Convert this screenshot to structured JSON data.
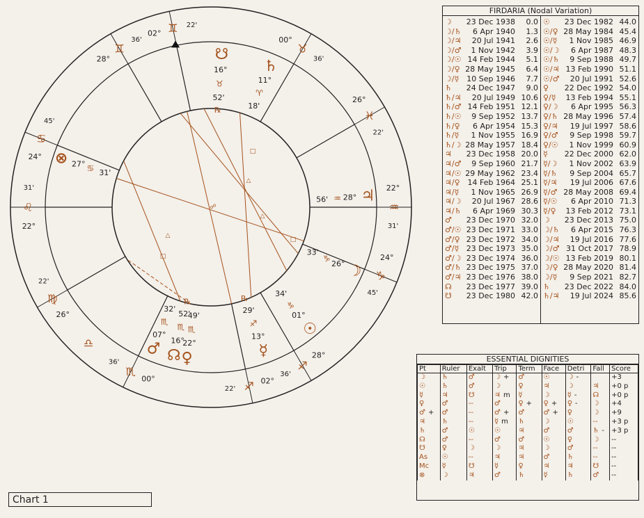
{
  "chart_label": "Chart 1",
  "wheel": {
    "cusps": [
      {
        "deg": "02°",
        "sign": "♊",
        "min": "22'"
      },
      {
        "deg": "00°",
        "sign": "♉",
        "min": "36'"
      },
      {
        "deg": "26°",
        "sign": "♓",
        "min": "22'"
      },
      {
        "deg": "22°",
        "sign": "♒",
        "min": "31'"
      },
      {
        "deg": "24°",
        "sign": "♑",
        "min": "45'"
      },
      {
        "deg": "28°",
        "sign": "♐",
        "min": "36'"
      },
      {
        "deg": "02°",
        "sign": "♐",
        "min": "22'"
      },
      {
        "deg": "00°",
        "sign": "♏",
        "min": "36'"
      },
      {
        "deg": "26°",
        "sign": "♍",
        "min": "22'"
      },
      {
        "deg": "22°",
        "sign": "♌",
        "min": "31'"
      },
      {
        "deg": "24°",
        "sign": "♋",
        "min": "45'"
      },
      {
        "deg": "28°",
        "sign": "♊",
        "min": "36'"
      }
    ],
    "extra_sign_glyph": "♎",
    "planets": [
      {
        "name": "south-node",
        "glyph": "☋",
        "deg": "16°",
        "sign": "♉",
        "min": "52'",
        "retro": "℞"
      },
      {
        "name": "saturn",
        "glyph": "♄",
        "deg": "11°",
        "sign": "♈",
        "min": "18'",
        "retro": ""
      },
      {
        "name": "jupiter",
        "glyph": "♃",
        "deg": "28°",
        "sign": "♒",
        "min": "56'",
        "retro": ""
      },
      {
        "name": "moon",
        "glyph": "☽",
        "deg": "26°",
        "sign": "♑",
        "min": "33'",
        "retro": ""
      },
      {
        "name": "sun",
        "glyph": "☉",
        "deg": "01°",
        "sign": "♑",
        "min": "34'",
        "retro": ""
      },
      {
        "name": "mercury",
        "glyph": "☿",
        "deg": "13°",
        "sign": "♐",
        "min": "29'",
        "retro": "℞"
      },
      {
        "name": "venus",
        "glyph": "♀",
        "deg": "22°",
        "sign": "♏",
        "min": "49'",
        "retro": ""
      },
      {
        "name": "north-node",
        "glyph": "☊",
        "deg": "16°",
        "sign": "♏",
        "min": "52'",
        "retro": "℞"
      },
      {
        "name": "mars",
        "glyph": "♂",
        "deg": "07°",
        "sign": "♏",
        "min": "32'",
        "retro": ""
      },
      {
        "name": "part-of-fortune",
        "glyph": "⊗",
        "deg": "27°",
        "sign": "♋",
        "min": "31'",
        "retro": ""
      }
    ],
    "aspect_glyphs": {
      "square": "□",
      "trine": "△",
      "opposition": "☍"
    }
  },
  "firdaria": {
    "title": "FIRDARIA (Nodal Variation)",
    "left": [
      {
        "g": "☽",
        "d": "23 Dec 1938",
        "a": "0.0"
      },
      {
        "g": "☽/♄",
        "d": "6 Apr 1940",
        "a": "1.3"
      },
      {
        "g": "☽/♃",
        "d": "20 Jul 1941",
        "a": "2.6"
      },
      {
        "g": "☽/♂",
        "d": "1 Nov 1942",
        "a": "3.9"
      },
      {
        "g": "☽/☉",
        "d": "14 Feb 1944",
        "a": "5.1"
      },
      {
        "g": "☽/♀",
        "d": "28 May 1945",
        "a": "6.4"
      },
      {
        "g": "☽/☿",
        "d": "10 Sep 1946",
        "a": "7.7"
      },
      {
        "g": "♄",
        "d": "24 Dec 1947",
        "a": "9.0"
      },
      {
        "g": "♄/♃",
        "d": "20 Jul 1949",
        "a": "10.6"
      },
      {
        "g": "♄/♂",
        "d": "14 Feb 1951",
        "a": "12.1"
      },
      {
        "g": "♄/☉",
        "d": "9 Sep 1952",
        "a": "13.7"
      },
      {
        "g": "♄/♀",
        "d": "6 Apr 1954",
        "a": "15.3"
      },
      {
        "g": "♄/☿",
        "d": "1 Nov 1955",
        "a": "16.9"
      },
      {
        "g": "♄/☽",
        "d": "28 May 1957",
        "a": "18.4"
      },
      {
        "g": "♃",
        "d": "23 Dec 1958",
        "a": "20.0"
      },
      {
        "g": "♃/♂",
        "d": "9 Sep 1960",
        "a": "21.7"
      },
      {
        "g": "♃/☉",
        "d": "29 May 1962",
        "a": "23.4"
      },
      {
        "g": "♃/♀",
        "d": "14 Feb 1964",
        "a": "25.1"
      },
      {
        "g": "♃/☿",
        "d": "1 Nov 1965",
        "a": "26.9"
      },
      {
        "g": "♃/☽",
        "d": "20 Jul 1967",
        "a": "28.6"
      },
      {
        "g": "♃/♄",
        "d": "6 Apr 1969",
        "a": "30.3"
      },
      {
        "g": "♂",
        "d": "23 Dec 1970",
        "a": "32.0"
      },
      {
        "g": "♂/☉",
        "d": "23 Dec 1971",
        "a": "33.0"
      },
      {
        "g": "♂/♀",
        "d": "23 Dec 1972",
        "a": "34.0"
      },
      {
        "g": "♂/☿",
        "d": "23 Dec 1973",
        "a": "35.0"
      },
      {
        "g": "♂/☽",
        "d": "23 Dec 1974",
        "a": "36.0"
      },
      {
        "g": "♂/♄",
        "d": "23 Dec 1975",
        "a": "37.0"
      },
      {
        "g": "♂/♃",
        "d": "23 Dec 1976",
        "a": "38.0"
      },
      {
        "g": "☊",
        "d": "23 Dec 1977",
        "a": "39.0"
      },
      {
        "g": "☋",
        "d": "23 Dec 1980",
        "a": "42.0"
      }
    ],
    "right": [
      {
        "g": "☉",
        "d": "23 Dec 1982",
        "a": "44.0"
      },
      {
        "g": "☉/♀",
        "d": "28 May 1984",
        "a": "45.4"
      },
      {
        "g": "☉/☿",
        "d": "1 Nov 1985",
        "a": "46.9"
      },
      {
        "g": "☉/☽",
        "d": "6 Apr 1987",
        "a": "48.3"
      },
      {
        "g": "☉/♄",
        "d": "9 Sep 1988",
        "a": "49.7"
      },
      {
        "g": "☉/♃",
        "d": "13 Feb 1990",
        "a": "51.1"
      },
      {
        "g": "☉/♂",
        "d": "20 Jul 1991",
        "a": "52.6"
      },
      {
        "g": "♀",
        "d": "22 Dec 1992",
        "a": "54.0"
      },
      {
        "g": "♀/☿",
        "d": "13 Feb 1994",
        "a": "55.1"
      },
      {
        "g": "♀/☽",
        "d": "6 Apr 1995",
        "a": "56.3"
      },
      {
        "g": "♀/♄",
        "d": "28 May 1996",
        "a": "57.4"
      },
      {
        "g": "♀/♃",
        "d": "19 Jul 1997",
        "a": "58.6"
      },
      {
        "g": "♀/♂",
        "d": "9 Sep 1998",
        "a": "59.7"
      },
      {
        "g": "♀/☉",
        "d": "1 Nov 1999",
        "a": "60.9"
      },
      {
        "g": "☿",
        "d": "22 Dec 2000",
        "a": "62.0"
      },
      {
        "g": "☿/☽",
        "d": "1 Nov 2002",
        "a": "63.9"
      },
      {
        "g": "☿/♄",
        "d": "9 Sep 2004",
        "a": "65.7"
      },
      {
        "g": "☿/♃",
        "d": "19 Jul 2006",
        "a": "67.6"
      },
      {
        "g": "☿/♂",
        "d": "28 May 2008",
        "a": "69.4"
      },
      {
        "g": "☿/☉",
        "d": "6 Apr 2010",
        "a": "71.3"
      },
      {
        "g": "☿/♀",
        "d": "13 Feb 2012",
        "a": "73.1"
      },
      {
        "g": "☽",
        "d": "23 Dec 2013",
        "a": "75.0"
      },
      {
        "g": "☽/♄",
        "d": "6 Apr 2015",
        "a": "76.3"
      },
      {
        "g": "☽/♃",
        "d": "19 Jul 2016",
        "a": "77.6"
      },
      {
        "g": "☽/♂",
        "d": "31 Oct 2017",
        "a": "78.9"
      },
      {
        "g": "☽/☉",
        "d": "13 Feb 2019",
        "a": "80.1"
      },
      {
        "g": "☽/♀",
        "d": "28 May 2020",
        "a": "81.4"
      },
      {
        "g": "☽/☿",
        "d": "9 Sep 2021",
        "a": "82.7"
      },
      {
        "g": "♄",
        "d": "23 Dec 2022",
        "a": "84.0"
      },
      {
        "g": "♄/♃",
        "d": "19 Jul 2024",
        "a": "85.6"
      }
    ]
  },
  "dignities": {
    "title": "ESSENTIAL DIGNITIES",
    "headers": [
      "Pt",
      "Ruler",
      "Exalt",
      "Trip",
      "Term",
      "Face",
      "Detri",
      "Fall",
      "Score"
    ],
    "rows": [
      [
        [
          "☽",
          ""
        ],
        [
          "♄",
          ""
        ],
        [
          "♂",
          ""
        ],
        [
          "☽",
          "+"
        ],
        [
          "♂",
          ""
        ],
        [
          "☉",
          ""
        ],
        [
          "☽",
          "-"
        ],
        [
          "",
          ""
        ],
        [
          "+3",
          ""
        ]
      ],
      [
        [
          "☉",
          ""
        ],
        [
          "♄",
          ""
        ],
        [
          "♂",
          ""
        ],
        [
          "☽",
          ""
        ],
        [
          "♀",
          ""
        ],
        [
          "♃",
          ""
        ],
        [
          "☽",
          ""
        ],
        [
          "♃",
          ""
        ],
        [
          "+0 p",
          ""
        ]
      ],
      [
        [
          "☿",
          ""
        ],
        [
          "♃",
          ""
        ],
        [
          "☋",
          ""
        ],
        [
          "♃",
          "m"
        ],
        [
          "☿",
          ""
        ],
        [
          "☽",
          ""
        ],
        [
          "☿",
          "-"
        ],
        [
          "☊",
          ""
        ],
        [
          "+0 p",
          ""
        ]
      ],
      [
        [
          "♀",
          ""
        ],
        [
          "♂",
          ""
        ],
        [
          "--",
          ""
        ],
        [
          "♂",
          ""
        ],
        [
          "♀",
          "+"
        ],
        [
          "♀",
          "+"
        ],
        [
          "♀",
          "-"
        ],
        [
          "☽",
          ""
        ],
        [
          "+4",
          ""
        ]
      ],
      [
        [
          "♂",
          "+"
        ],
        [
          "♂",
          ""
        ],
        [
          "--",
          ""
        ],
        [
          "♂",
          "+"
        ],
        [
          "♂",
          ""
        ],
        [
          "♂",
          "+"
        ],
        [
          "♀",
          ""
        ],
        [
          "☽",
          ""
        ],
        [
          "+9",
          ""
        ]
      ],
      [
        [
          "♃",
          ""
        ],
        [
          "♄",
          ""
        ],
        [
          "--",
          ""
        ],
        [
          "☿",
          "m"
        ],
        [
          "♄",
          ""
        ],
        [
          "☽",
          ""
        ],
        [
          "☉",
          ""
        ],
        [
          "--",
          ""
        ],
        [
          "+3 p",
          ""
        ]
      ],
      [
        [
          "♄",
          ""
        ],
        [
          "♂",
          ""
        ],
        [
          "☉",
          ""
        ],
        [
          "☉",
          ""
        ],
        [
          "♃",
          ""
        ],
        [
          "♂",
          ""
        ],
        [
          "♂",
          ""
        ],
        [
          "♄",
          "-"
        ],
        [
          "+3 p",
          ""
        ]
      ],
      [
        [
          "☊",
          ""
        ],
        [
          "♂",
          ""
        ],
        [
          "--",
          ""
        ],
        [
          "♂",
          ""
        ],
        [
          "♂",
          ""
        ],
        [
          "☉",
          ""
        ],
        [
          "♀",
          ""
        ],
        [
          "☽",
          ""
        ],
        [
          "--",
          ""
        ]
      ],
      [
        [
          "☋",
          ""
        ],
        [
          "♀",
          ""
        ],
        [
          "☽",
          ""
        ],
        [
          "☽",
          ""
        ],
        [
          "♃",
          ""
        ],
        [
          "☽",
          ""
        ],
        [
          "♂",
          ""
        ],
        [
          "--",
          ""
        ],
        [
          "--",
          ""
        ]
      ],
      [
        [
          "As",
          ""
        ],
        [
          "☉",
          ""
        ],
        [
          "--",
          ""
        ],
        [
          "♃",
          ""
        ],
        [
          "♃",
          ""
        ],
        [
          "♂",
          ""
        ],
        [
          "♄",
          ""
        ],
        [
          "--",
          ""
        ],
        [
          "--",
          ""
        ]
      ],
      [
        [
          "Mc",
          ""
        ],
        [
          "☿",
          ""
        ],
        [
          "☋",
          ""
        ],
        [
          "☿",
          ""
        ],
        [
          "♀",
          ""
        ],
        [
          "♃",
          ""
        ],
        [
          "♃",
          ""
        ],
        [
          "☋",
          ""
        ],
        [
          "--",
          ""
        ]
      ],
      [
        [
          "⊗",
          ""
        ],
        [
          "☽",
          ""
        ],
        [
          "♃",
          ""
        ],
        [
          "♂",
          ""
        ],
        [
          "♄",
          ""
        ],
        [
          "☿",
          ""
        ],
        [
          "♄",
          ""
        ],
        [
          "♂",
          ""
        ],
        [
          "--",
          ""
        ]
      ]
    ]
  }
}
